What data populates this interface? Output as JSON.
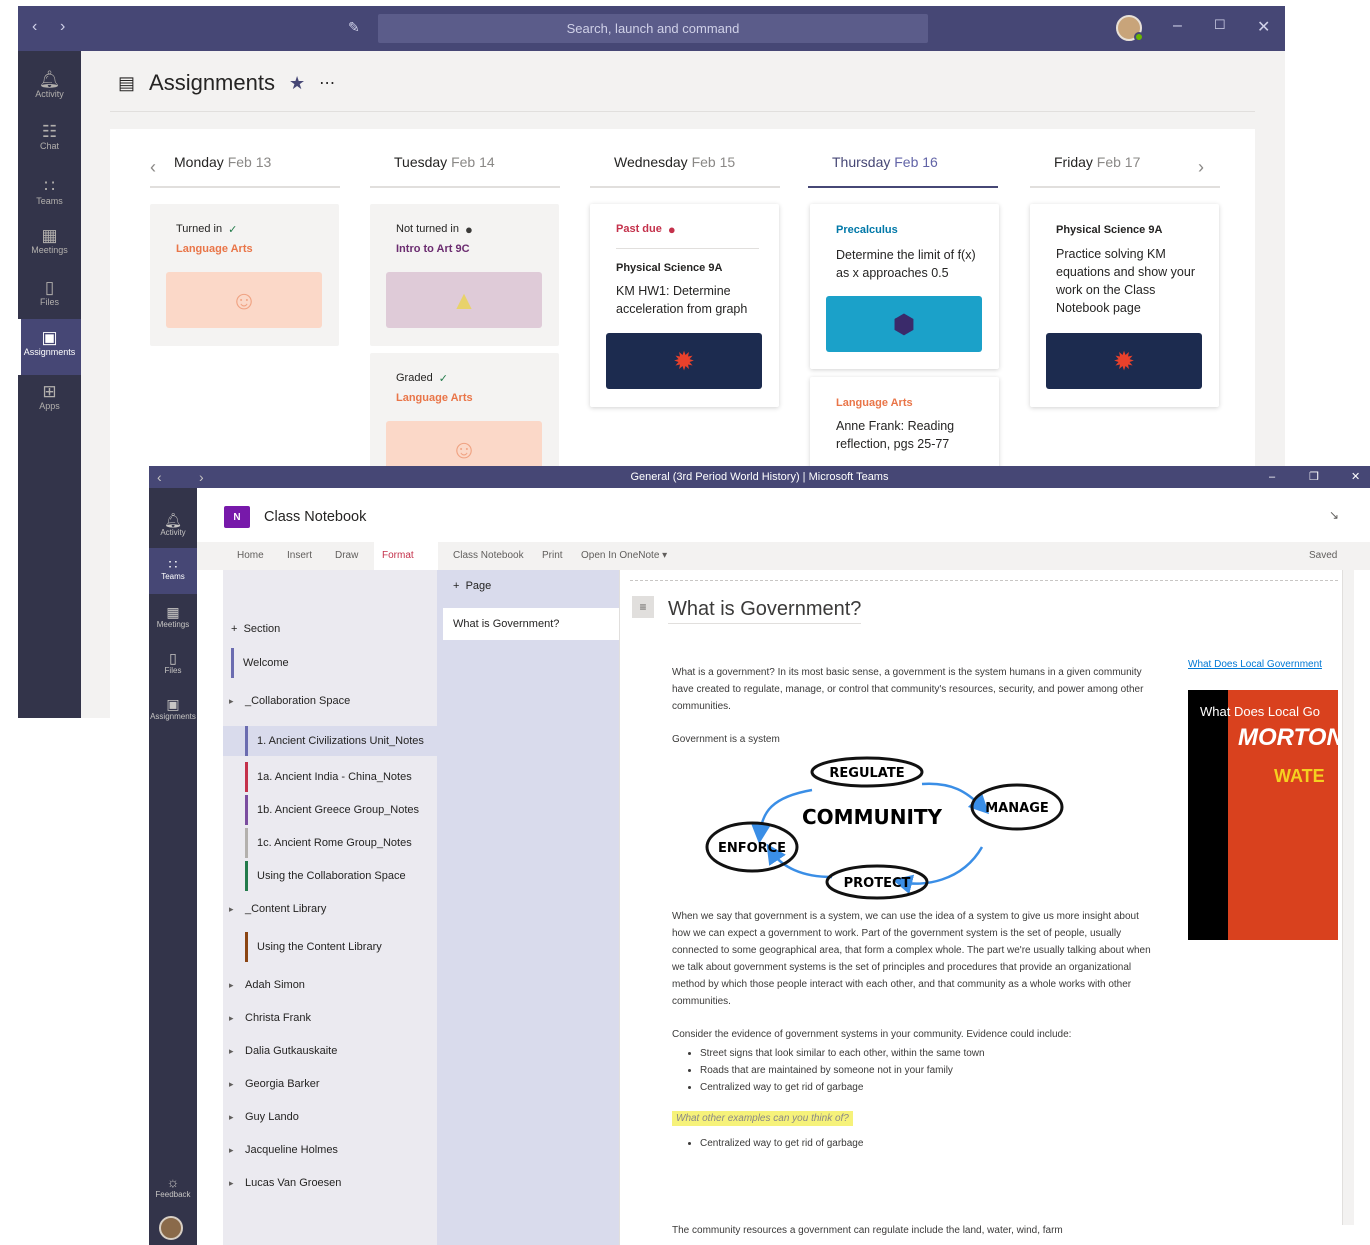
{
  "teams": {
    "search_placeholder": "Search, launch and command",
    "rail": [
      "Activity",
      "Chat",
      "Teams",
      "Meetings",
      "Files",
      "Assignments",
      "Apps"
    ],
    "app_title": "Assignments",
    "days": [
      {
        "day": "Monday",
        "date": "Feb 13"
      },
      {
        "day": "Tuesday",
        "date": "Feb 14"
      },
      {
        "day": "Wednesday",
        "date": "Feb 15"
      },
      {
        "day": "Thursday",
        "date": "Feb 16"
      },
      {
        "day": "Friday",
        "date": "Feb 17"
      }
    ],
    "cards": {
      "mon1": {
        "status": "Turned in",
        "subject": "Language Arts"
      },
      "tue1": {
        "status": "Not turned in",
        "subject": "Intro to Art 9C"
      },
      "tue2": {
        "status": "Graded",
        "subject": "Language Arts"
      },
      "wed1": {
        "status": "Past due",
        "subject": "Physical Science 9A",
        "title": "KM HW1: Determine acceleration from graph"
      },
      "thu1": {
        "subject": "Precalculus",
        "title": "Determine the limit of f(x) as x approaches 0.5"
      },
      "thu2": {
        "subject": "Language Arts",
        "title": "Anne Frank: Reading reflection, pgs 25-77"
      },
      "fri1": {
        "subject": "Physical Science 9A",
        "title": "Practice solving KM equations and show your work on the Class Notebook page"
      }
    },
    "colors": {
      "brand": "#464775",
      "rail": "#33344a",
      "language_arts": "#e97548",
      "art": "#6b2c70",
      "past_due": "#c4314b",
      "precalc": "#0078a8",
      "phys": "#252423"
    }
  },
  "notebook_window": {
    "title": "General (3rd Period World History) | Microsoft Teams",
    "rail": [
      "Activity",
      "Teams",
      "Meetings",
      "Files",
      "Assignments",
      "Feedback"
    ],
    "app_title": "Class Notebook",
    "ribbon_tabs": [
      "Home",
      "Insert",
      "Draw",
      "Format",
      "Class Notebook",
      "Print",
      "Open In OneNote ▾"
    ],
    "saved": "Saved",
    "add_section": "Section",
    "add_page": "Page",
    "sections": [
      {
        "label": "Welcome",
        "color": "#6b6cb0"
      },
      {
        "label": "_Collaboration Space",
        "group": true
      },
      {
        "label": "1. Ancient Civilizations Unit_Notes",
        "color": "#6b6cb0",
        "selected": true
      },
      {
        "label": "1a. Ancient India - China_Notes",
        "color": "#c4314b"
      },
      {
        "label": "1b. Ancient Greece Group_Notes",
        "color": "#7b4d9f"
      },
      {
        "label": "1c. Ancient Rome Group_Notes",
        "color": "#b3b0ad"
      },
      {
        "label": "Using the Collaboration Space",
        "color": "#237b4b"
      },
      {
        "label": "_Content Library",
        "group": true
      },
      {
        "label": "Using the Content Library",
        "color": "#8b4513"
      },
      {
        "label": "Adah Simon",
        "group": true
      },
      {
        "label": "Christa Frank",
        "group": true
      },
      {
        "label": "Dalia Gutkauskaite",
        "group": true
      },
      {
        "label": "Georgia Barker",
        "group": true
      },
      {
        "label": "Guy Lando",
        "group": true
      },
      {
        "label": "Jacqueline Holmes",
        "group": true
      },
      {
        "label": "Lucas Van Groesen",
        "group": true
      }
    ],
    "pages": [
      "What is Government?"
    ],
    "page_title": "What is Government?",
    "para1": "What is a government? In its most basic sense, a government is the system humans in a given community have created to regulate, manage, or control that community's resources, security, and power among other communities.",
    "para2": "Government is a system",
    "sketch_words": [
      "REGULATE",
      "COMMUNITY",
      "MANAGE",
      "ENFORCE",
      "PROTECT"
    ],
    "para3": "When we say that government is a system, we can use the idea of a system to give us more insight about how we can expect a government to work. Part of the government system is the set of people, usually connected to some geographical area, that form a complex whole. The part we're usually talking about when we talk about government systems is the set of principles and procedures that provide an organizational method by which those people interact with each other, and that community as a whole works with other communities.",
    "para4": "Consider the evidence of government systems in your community. Evidence could include:",
    "bullets": [
      "Street signs that look similar to each other, within the same town",
      "Roads that are maintained by someone not in your family",
      "Centralized way to get rid of garbage"
    ],
    "question": "What other examples can you think of?",
    "answer": "Centralized way to get rid of garbage",
    "para5": "The community resources a government can regulate include the land, water, wind, farm",
    "link": "What Does Local Government",
    "video_caption": "What Does Local Go",
    "video_sign1": "MORTON",
    "video_sign2": "WATE"
  }
}
